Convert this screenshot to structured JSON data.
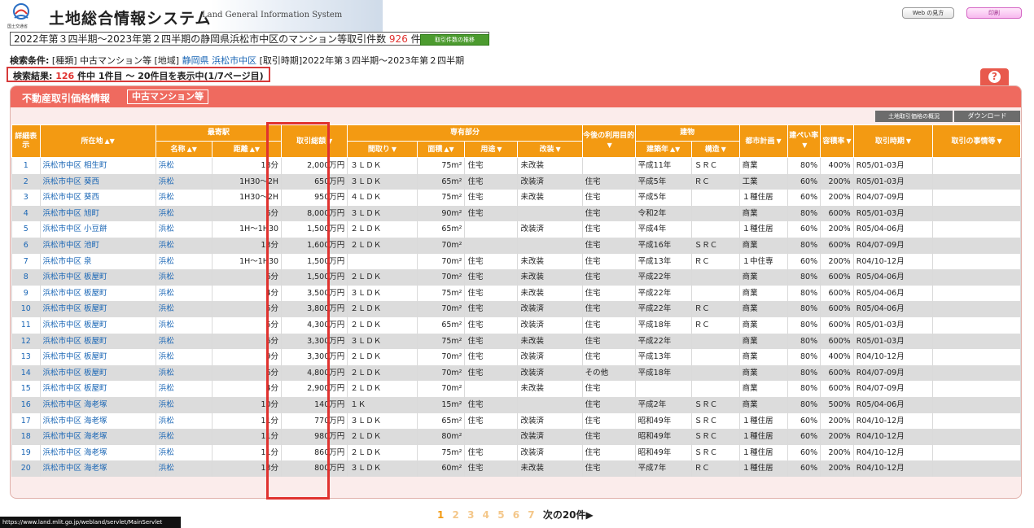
{
  "header": {
    "ministry": "国土交通省",
    "title": "土地総合情報システム",
    "subtitle": "Land General Information System",
    "web_help_label": "Web の見方",
    "pink_button_label": "印刷"
  },
  "count_bar": {
    "prefix": "2022年第３四半期～2023年第２四半期の静岡県浜松市中区のマンション等取引件数",
    "count": "926",
    "suffix": "件",
    "trend_button": "取引件数の推移"
  },
  "conditions": {
    "label": "検索条件:",
    "kind": "[種類] 中古マンション等",
    "area_label": "[地域]",
    "area_pref": "静岡県",
    "area_city": "浜松市中区",
    "period": "[取引時期]2022年第３四半期～2023年第２四半期"
  },
  "result": {
    "label": "検索結果:",
    "total": "126",
    "range": "件中 1件目 ～ 20件目を表示中(1/7ページ目)"
  },
  "help_icon": "?",
  "panel": {
    "title": "不動産取引価格情報",
    "tag": "中古マンション等",
    "overview_button": "土地取引価格の概況",
    "download_button": "ダウンロード"
  },
  "table": {
    "headers": {
      "detail": "詳細表示",
      "location": "所在地",
      "station": "最寄駅",
      "station_name": "名称",
      "station_distance": "距離",
      "total_price": "取引総額",
      "exclusive": "専有部分",
      "layout": "間取り",
      "area": "面積",
      "use": "用途",
      "renovation": "改装",
      "future_use": "今後の利用目的",
      "building": "建物",
      "built_year": "建築年",
      "structure": "構造",
      "city_plan": "都市計画",
      "coverage": "建ぺい率",
      "far": "容積率",
      "period": "取引時期",
      "circumstances": "取引の事情等"
    },
    "rows": [
      {
        "no": "1",
        "loc": "浜松市中区 相生町",
        "st": "浜松",
        "dist": "18分",
        "price": "2,000万円",
        "layout": "３ＬＤＫ",
        "area": "75m²",
        "use": "住宅",
        "reno": "未改装",
        "future": "",
        "built": "平成11年",
        "struct": "ＳＲＣ",
        "plan": "商業",
        "cov": "80%",
        "far": "400%",
        "period": "R05/01-03月",
        "circ": ""
      },
      {
        "no": "2",
        "loc": "浜松市中区 葵西",
        "st": "浜松",
        "dist": "1H30～2H",
        "price": "650万円",
        "layout": "３ＬＤＫ",
        "area": "65m²",
        "use": "住宅",
        "reno": "改装済",
        "future": "住宅",
        "built": "平成5年",
        "struct": "ＲＣ",
        "plan": "工業",
        "cov": "60%",
        "far": "200%",
        "period": "R05/01-03月",
        "circ": ""
      },
      {
        "no": "3",
        "loc": "浜松市中区 葵西",
        "st": "浜松",
        "dist": "1H30～2H",
        "price": "950万円",
        "layout": "４ＬＤＫ",
        "area": "75m²",
        "use": "住宅",
        "reno": "未改装",
        "future": "住宅",
        "built": "平成5年",
        "struct": "",
        "plan": "１種住居",
        "cov": "60%",
        "far": "200%",
        "period": "R04/07-09月",
        "circ": ""
      },
      {
        "no": "4",
        "loc": "浜松市中区 旭町",
        "st": "浜松",
        "dist": "6分",
        "price": "8,000万円",
        "layout": "３ＬＤＫ",
        "area": "90m²",
        "use": "住宅",
        "reno": "",
        "future": "住宅",
        "built": "令和2年",
        "struct": "",
        "plan": "商業",
        "cov": "80%",
        "far": "600%",
        "period": "R05/01-03月",
        "circ": ""
      },
      {
        "no": "5",
        "loc": "浜松市中区 小豆餅",
        "st": "浜松",
        "dist": "1H～1H30",
        "price": "1,500万円",
        "layout": "２ＬＤＫ",
        "area": "65m²",
        "use": "",
        "reno": "改装済",
        "future": "住宅",
        "built": "平成4年",
        "struct": "",
        "plan": "１種住居",
        "cov": "60%",
        "far": "200%",
        "period": "R05/04-06月",
        "circ": ""
      },
      {
        "no": "6",
        "loc": "浜松市中区 池町",
        "st": "浜松",
        "dist": "13分",
        "price": "1,600万円",
        "layout": "２ＬＤＫ",
        "area": "70m²",
        "use": "",
        "reno": "",
        "future": "住宅",
        "built": "平成16年",
        "struct": "ＳＲＣ",
        "plan": "商業",
        "cov": "80%",
        "far": "600%",
        "period": "R04/07-09月",
        "circ": ""
      },
      {
        "no": "7",
        "loc": "浜松市中区 泉",
        "st": "浜松",
        "dist": "1H～1H30",
        "price": "1,500万円",
        "layout": "",
        "area": "70m²",
        "use": "住宅",
        "reno": "未改装",
        "future": "住宅",
        "built": "平成13年",
        "struct": "ＲＣ",
        "plan": "１中住専",
        "cov": "60%",
        "far": "200%",
        "period": "R04/10-12月",
        "circ": ""
      },
      {
        "no": "8",
        "loc": "浜松市中区 板屋町",
        "st": "浜松",
        "dist": "6分",
        "price": "1,500万円",
        "layout": "２ＬＤＫ",
        "area": "70m²",
        "use": "住宅",
        "reno": "未改装",
        "future": "住宅",
        "built": "平成22年",
        "struct": "",
        "plan": "商業",
        "cov": "80%",
        "far": "600%",
        "period": "R05/04-06月",
        "circ": ""
      },
      {
        "no": "9",
        "loc": "浜松市中区 板屋町",
        "st": "浜松",
        "dist": "4分",
        "price": "3,500万円",
        "layout": "３ＬＤＫ",
        "area": "75m²",
        "use": "住宅",
        "reno": "未改装",
        "future": "住宅",
        "built": "平成22年",
        "struct": "",
        "plan": "商業",
        "cov": "80%",
        "far": "600%",
        "period": "R05/04-06月",
        "circ": ""
      },
      {
        "no": "10",
        "loc": "浜松市中区 板屋町",
        "st": "浜松",
        "dist": "5分",
        "price": "3,800万円",
        "layout": "２ＬＤＫ",
        "area": "70m²",
        "use": "住宅",
        "reno": "改装済",
        "future": "住宅",
        "built": "平成22年",
        "struct": "ＲＣ",
        "plan": "商業",
        "cov": "80%",
        "far": "600%",
        "period": "R05/04-06月",
        "circ": ""
      },
      {
        "no": "11",
        "loc": "浜松市中区 板屋町",
        "st": "浜松",
        "dist": "5分",
        "price": "4,300万円",
        "layout": "２ＬＤＫ",
        "area": "65m²",
        "use": "住宅",
        "reno": "改装済",
        "future": "住宅",
        "built": "平成18年",
        "struct": "ＲＣ",
        "plan": "商業",
        "cov": "80%",
        "far": "600%",
        "period": "R05/01-03月",
        "circ": ""
      },
      {
        "no": "12",
        "loc": "浜松市中区 板屋町",
        "st": "浜松",
        "dist": "6分",
        "price": "3,300万円",
        "layout": "３ＬＤＫ",
        "area": "75m²",
        "use": "住宅",
        "reno": "未改装",
        "future": "住宅",
        "built": "平成22年",
        "struct": "",
        "plan": "商業",
        "cov": "80%",
        "far": "600%",
        "period": "R05/01-03月",
        "circ": ""
      },
      {
        "no": "13",
        "loc": "浜松市中区 板屋町",
        "st": "浜松",
        "dist": "9分",
        "price": "3,300万円",
        "layout": "２ＬＤＫ",
        "area": "70m²",
        "use": "住宅",
        "reno": "改装済",
        "future": "住宅",
        "built": "平成13年",
        "struct": "",
        "plan": "商業",
        "cov": "80%",
        "far": "400%",
        "period": "R04/10-12月",
        "circ": ""
      },
      {
        "no": "14",
        "loc": "浜松市中区 板屋町",
        "st": "浜松",
        "dist": "6分",
        "price": "4,800万円",
        "layout": "２ＬＤＫ",
        "area": "70m²",
        "use": "住宅",
        "reno": "改装済",
        "future": "その他",
        "built": "平成18年",
        "struct": "",
        "plan": "商業",
        "cov": "80%",
        "far": "600%",
        "period": "R04/07-09月",
        "circ": ""
      },
      {
        "no": "15",
        "loc": "浜松市中区 板屋町",
        "st": "浜松",
        "dist": "4分",
        "price": "2,900万円",
        "layout": "２ＬＤＫ",
        "area": "70m²",
        "use": "",
        "reno": "未改装",
        "future": "住宅",
        "built": "",
        "struct": "",
        "plan": "商業",
        "cov": "80%",
        "far": "600%",
        "period": "R04/07-09月",
        "circ": ""
      },
      {
        "no": "16",
        "loc": "浜松市中区 海老塚",
        "st": "浜松",
        "dist": "10分",
        "price": "140万円",
        "layout": "１Ｋ",
        "area": "15m²",
        "use": "住宅",
        "reno": "",
        "future": "住宅",
        "built": "平成2年",
        "struct": "ＳＲＣ",
        "plan": "商業",
        "cov": "80%",
        "far": "500%",
        "period": "R05/04-06月",
        "circ": ""
      },
      {
        "no": "17",
        "loc": "浜松市中区 海老塚",
        "st": "浜松",
        "dist": "11分",
        "price": "770万円",
        "layout": "３ＬＤＫ",
        "area": "65m²",
        "use": "住宅",
        "reno": "改装済",
        "future": "住宅",
        "built": "昭和49年",
        "struct": "ＳＲＣ",
        "plan": "１種住居",
        "cov": "60%",
        "far": "200%",
        "period": "R04/10-12月",
        "circ": ""
      },
      {
        "no": "18",
        "loc": "浜松市中区 海老塚",
        "st": "浜松",
        "dist": "11分",
        "price": "980万円",
        "layout": "２ＬＤＫ",
        "area": "80m²",
        "use": "",
        "reno": "改装済",
        "future": "住宅",
        "built": "昭和49年",
        "struct": "ＳＲＣ",
        "plan": "１種住居",
        "cov": "60%",
        "far": "200%",
        "period": "R04/10-12月",
        "circ": ""
      },
      {
        "no": "19",
        "loc": "浜松市中区 海老塚",
        "st": "浜松",
        "dist": "11分",
        "price": "860万円",
        "layout": "２ＬＤＫ",
        "area": "75m²",
        "use": "住宅",
        "reno": "改装済",
        "future": "住宅",
        "built": "昭和49年",
        "struct": "ＳＲＣ",
        "plan": "１種住居",
        "cov": "60%",
        "far": "200%",
        "period": "R04/10-12月",
        "circ": ""
      },
      {
        "no": "20",
        "loc": "浜松市中区 海老塚",
        "st": "浜松",
        "dist": "13分",
        "price": "800万円",
        "layout": "３ＬＤＫ",
        "area": "60m²",
        "use": "住宅",
        "reno": "未改装",
        "future": "住宅",
        "built": "平成7年",
        "struct": "ＲＣ",
        "plan": "１種住居",
        "cov": "60%",
        "far": "200%",
        "period": "R04/10-12月",
        "circ": ""
      }
    ]
  },
  "pager": {
    "current": "1",
    "pages": [
      "2",
      "3",
      "4",
      "5",
      "6",
      "7"
    ],
    "next": "次の20件▶"
  },
  "status_url": "https://www.land.mlit.go.jp/webland/servlet/MainServlet",
  "colors": {
    "header_orange": "#f39a12",
    "panel_red": "#ef6a5f",
    "highlight_red": "#e0322f",
    "link_blue": "#1a66b5"
  }
}
